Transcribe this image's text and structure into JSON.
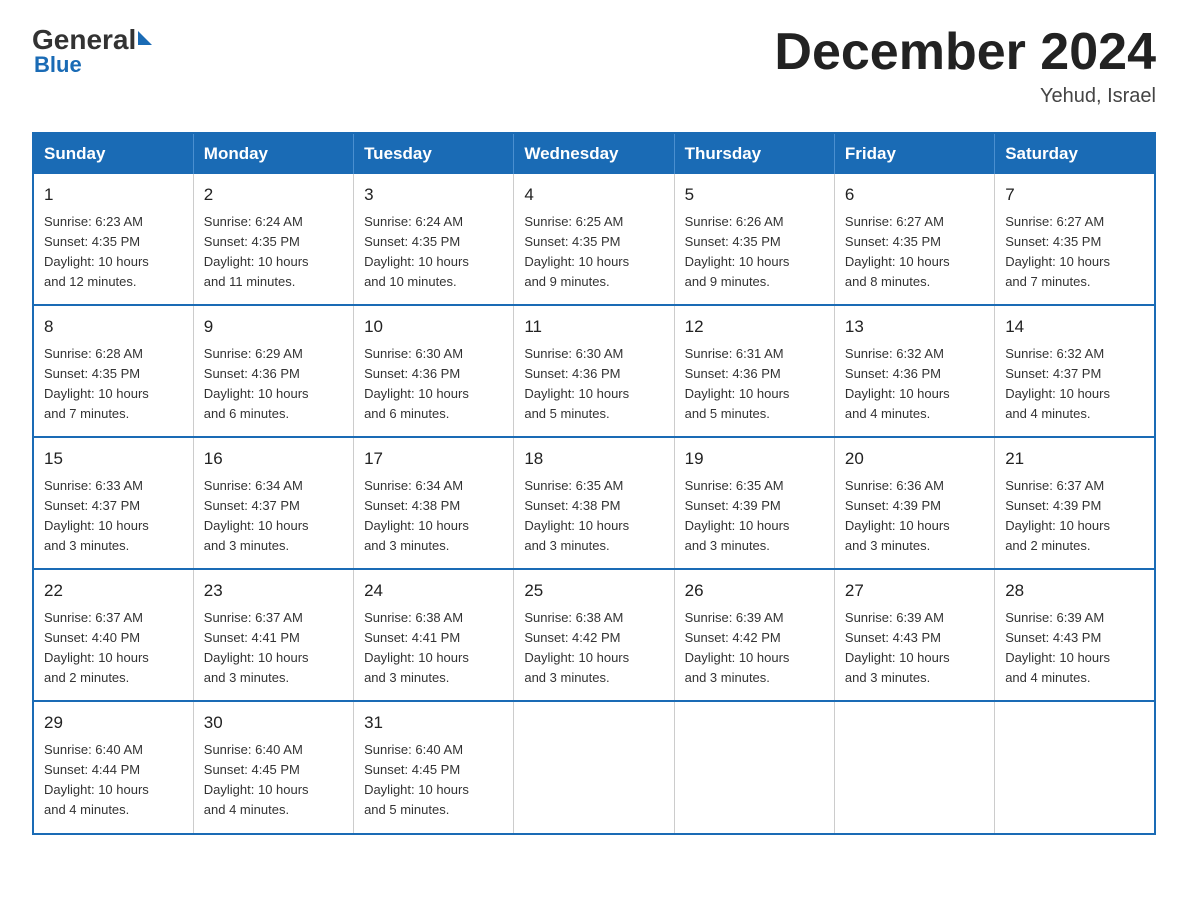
{
  "logo": {
    "general": "General",
    "blue": "Blue"
  },
  "header": {
    "title": "December 2024",
    "subtitle": "Yehud, Israel"
  },
  "days_of_week": [
    "Sunday",
    "Monday",
    "Tuesday",
    "Wednesday",
    "Thursday",
    "Friday",
    "Saturday"
  ],
  "weeks": [
    [
      {
        "day": "1",
        "sunrise": "6:23 AM",
        "sunset": "4:35 PM",
        "daylight": "10 hours and 12 minutes."
      },
      {
        "day": "2",
        "sunrise": "6:24 AM",
        "sunset": "4:35 PM",
        "daylight": "10 hours and 11 minutes."
      },
      {
        "day": "3",
        "sunrise": "6:24 AM",
        "sunset": "4:35 PM",
        "daylight": "10 hours and 10 minutes."
      },
      {
        "day": "4",
        "sunrise": "6:25 AM",
        "sunset": "4:35 PM",
        "daylight": "10 hours and 9 minutes."
      },
      {
        "day": "5",
        "sunrise": "6:26 AM",
        "sunset": "4:35 PM",
        "daylight": "10 hours and 9 minutes."
      },
      {
        "day": "6",
        "sunrise": "6:27 AM",
        "sunset": "4:35 PM",
        "daylight": "10 hours and 8 minutes."
      },
      {
        "day": "7",
        "sunrise": "6:27 AM",
        "sunset": "4:35 PM",
        "daylight": "10 hours and 7 minutes."
      }
    ],
    [
      {
        "day": "8",
        "sunrise": "6:28 AM",
        "sunset": "4:35 PM",
        "daylight": "10 hours and 7 minutes."
      },
      {
        "day": "9",
        "sunrise": "6:29 AM",
        "sunset": "4:36 PM",
        "daylight": "10 hours and 6 minutes."
      },
      {
        "day": "10",
        "sunrise": "6:30 AM",
        "sunset": "4:36 PM",
        "daylight": "10 hours and 6 minutes."
      },
      {
        "day": "11",
        "sunrise": "6:30 AM",
        "sunset": "4:36 PM",
        "daylight": "10 hours and 5 minutes."
      },
      {
        "day": "12",
        "sunrise": "6:31 AM",
        "sunset": "4:36 PM",
        "daylight": "10 hours and 5 minutes."
      },
      {
        "day": "13",
        "sunrise": "6:32 AM",
        "sunset": "4:36 PM",
        "daylight": "10 hours and 4 minutes."
      },
      {
        "day": "14",
        "sunrise": "6:32 AM",
        "sunset": "4:37 PM",
        "daylight": "10 hours and 4 minutes."
      }
    ],
    [
      {
        "day": "15",
        "sunrise": "6:33 AM",
        "sunset": "4:37 PM",
        "daylight": "10 hours and 3 minutes."
      },
      {
        "day": "16",
        "sunrise": "6:34 AM",
        "sunset": "4:37 PM",
        "daylight": "10 hours and 3 minutes."
      },
      {
        "day": "17",
        "sunrise": "6:34 AM",
        "sunset": "4:38 PM",
        "daylight": "10 hours and 3 minutes."
      },
      {
        "day": "18",
        "sunrise": "6:35 AM",
        "sunset": "4:38 PM",
        "daylight": "10 hours and 3 minutes."
      },
      {
        "day": "19",
        "sunrise": "6:35 AM",
        "sunset": "4:39 PM",
        "daylight": "10 hours and 3 minutes."
      },
      {
        "day": "20",
        "sunrise": "6:36 AM",
        "sunset": "4:39 PM",
        "daylight": "10 hours and 3 minutes."
      },
      {
        "day": "21",
        "sunrise": "6:37 AM",
        "sunset": "4:39 PM",
        "daylight": "10 hours and 2 minutes."
      }
    ],
    [
      {
        "day": "22",
        "sunrise": "6:37 AM",
        "sunset": "4:40 PM",
        "daylight": "10 hours and 2 minutes."
      },
      {
        "day": "23",
        "sunrise": "6:37 AM",
        "sunset": "4:41 PM",
        "daylight": "10 hours and 3 minutes."
      },
      {
        "day": "24",
        "sunrise": "6:38 AM",
        "sunset": "4:41 PM",
        "daylight": "10 hours and 3 minutes."
      },
      {
        "day": "25",
        "sunrise": "6:38 AM",
        "sunset": "4:42 PM",
        "daylight": "10 hours and 3 minutes."
      },
      {
        "day": "26",
        "sunrise": "6:39 AM",
        "sunset": "4:42 PM",
        "daylight": "10 hours and 3 minutes."
      },
      {
        "day": "27",
        "sunrise": "6:39 AM",
        "sunset": "4:43 PM",
        "daylight": "10 hours and 3 minutes."
      },
      {
        "day": "28",
        "sunrise": "6:39 AM",
        "sunset": "4:43 PM",
        "daylight": "10 hours and 4 minutes."
      }
    ],
    [
      {
        "day": "29",
        "sunrise": "6:40 AM",
        "sunset": "4:44 PM",
        "daylight": "10 hours and 4 minutes."
      },
      {
        "day": "30",
        "sunrise": "6:40 AM",
        "sunset": "4:45 PM",
        "daylight": "10 hours and 4 minutes."
      },
      {
        "day": "31",
        "sunrise": "6:40 AM",
        "sunset": "4:45 PM",
        "daylight": "10 hours and 5 minutes."
      },
      null,
      null,
      null,
      null
    ]
  ],
  "labels": {
    "sunrise": "Sunrise:",
    "sunset": "Sunset:",
    "daylight": "Daylight:"
  }
}
